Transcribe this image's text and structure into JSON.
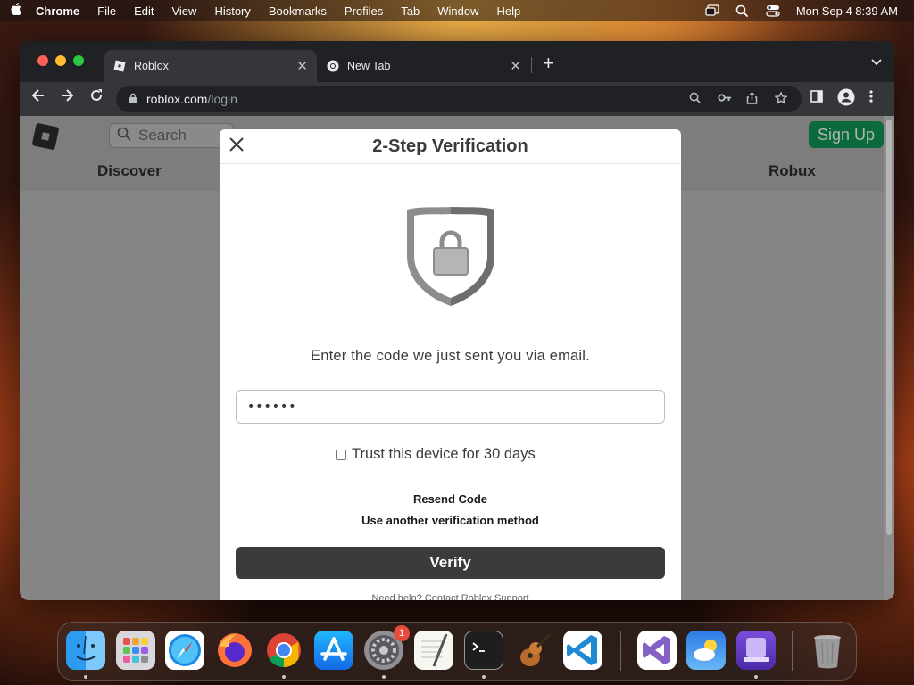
{
  "menubar": {
    "app_name": "Chrome",
    "menus": [
      "File",
      "Edit",
      "View",
      "History",
      "Bookmarks",
      "Profiles",
      "Tab",
      "Window",
      "Help"
    ],
    "clock": "Mon Sep 4  8:39 AM"
  },
  "browser": {
    "tabs": [
      {
        "title": "Roblox",
        "active": true
      },
      {
        "title": "New Tab",
        "active": false
      }
    ],
    "url_host": "roblox.com",
    "url_path": "/login"
  },
  "roblox": {
    "search_placeholder": "Search",
    "signup_label": "Sign Up",
    "nav": {
      "discover": "Discover",
      "robux": "Robux"
    }
  },
  "modal": {
    "title": "2-Step Verification",
    "instruction": "Enter the code we just sent you via email.",
    "code_value": "••••••",
    "trust_label": "Trust this device for 30 days",
    "trust_checked": false,
    "resend_label": "Resend Code",
    "other_method_label": "Use another verification method",
    "verify_label": "Verify",
    "help_text": "Need help? Contact Roblox Support"
  },
  "dock": {
    "apps": [
      "finder-icon",
      "launchpad-icon",
      "safari-icon",
      "firefox-icon",
      "chrome-icon",
      "app-store-icon",
      "system-settings-icon",
      "textedit-icon",
      "terminal-icon",
      "garageband-icon",
      "vscode-icon",
      "visual-studio-icon",
      "weather-icon",
      "simulator-icon",
      "trash-icon"
    ],
    "settings_badge": "1"
  }
}
